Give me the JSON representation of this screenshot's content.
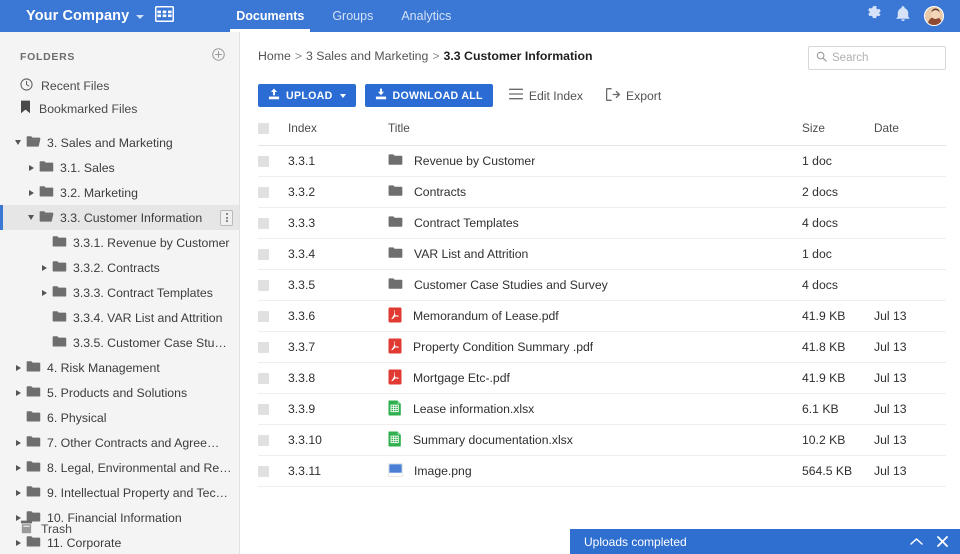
{
  "topbar": {
    "brand": "Your Company",
    "brand_caret_icon": "chevron-down-icon",
    "grid_icon": "grid-icon",
    "tabs": [
      {
        "label": "Documents",
        "active": true
      },
      {
        "label": "Groups",
        "active": false
      },
      {
        "label": "Analytics",
        "active": false
      }
    ],
    "gear_icon": "gear-icon",
    "bell_icon": "bell-icon",
    "avatar_icon": "avatar",
    "bg_color": "#3b77d4"
  },
  "sidebar": {
    "heading": "FOLDERS",
    "add_icon": "plus-circle-icon",
    "links": [
      {
        "label": "Recent Files",
        "icon": "clock-icon"
      },
      {
        "label": "Bookmarked Files",
        "icon": "bookmark-icon"
      }
    ],
    "tree": [
      {
        "label": "3. Sales and Marketing",
        "depth": 0,
        "caret": "down",
        "folder": "open",
        "selected": false
      },
      {
        "label": "3.1. Sales",
        "depth": 1,
        "caret": "right",
        "folder": "closed",
        "selected": false
      },
      {
        "label": "3.2. Marketing",
        "depth": 1,
        "caret": "right",
        "folder": "closed",
        "selected": false
      },
      {
        "label": "3.3. Customer Information",
        "depth": 1,
        "caret": "down",
        "folder": "open",
        "selected": true,
        "kebab": true
      },
      {
        "label": "3.3.1. Revenue by Customer",
        "depth": 2,
        "caret": "none",
        "folder": "closed",
        "selected": false
      },
      {
        "label": "3.3.2. Contracts",
        "depth": 2,
        "caret": "right",
        "folder": "closed",
        "selected": false
      },
      {
        "label": "3.3.3. Contract Templates",
        "depth": 2,
        "caret": "right",
        "folder": "closed",
        "selected": false
      },
      {
        "label": "3.3.4. VAR List and Attrition",
        "depth": 2,
        "caret": "none",
        "folder": "closed",
        "selected": false
      },
      {
        "label": "3.3.5. Customer Case Studi…",
        "depth": 2,
        "caret": "none",
        "folder": "closed",
        "selected": false
      },
      {
        "label": "4. Risk Management",
        "depth": 0,
        "caret": "right",
        "folder": "closed",
        "selected": false
      },
      {
        "label": "5. Products and Solutions",
        "depth": 0,
        "caret": "right",
        "folder": "closed",
        "selected": false
      },
      {
        "label": "6. Physical",
        "depth": 0,
        "caret": "none",
        "folder": "closed",
        "selected": false
      },
      {
        "label": "7. Other Contracts and Agree…",
        "depth": 0,
        "caret": "right",
        "folder": "closed",
        "selected": false
      },
      {
        "label": "8. Legal, Environmental and Re…",
        "depth": 0,
        "caret": "right",
        "folder": "closed",
        "selected": false
      },
      {
        "label": "9. Intellectual Property and Tec…",
        "depth": 0,
        "caret": "right",
        "folder": "closed",
        "selected": false
      },
      {
        "label": "10. Financial Information",
        "depth": 0,
        "caret": "right",
        "folder": "closed",
        "selected": false
      },
      {
        "label": "11. Corporate",
        "depth": 0,
        "caret": "right",
        "folder": "closed",
        "selected": false
      }
    ],
    "trash": {
      "label": "Trash",
      "icon": "trash-icon"
    }
  },
  "main": {
    "breadcrumb": [
      {
        "label": "Home",
        "current": false
      },
      {
        "label": "3 Sales and Marketing",
        "current": false
      },
      {
        "label": "3.3 Customer Information",
        "current": true
      }
    ],
    "breadcrumb_separator": ">",
    "search": {
      "placeholder": "Search",
      "value": "",
      "icon": "search-icon"
    },
    "toolbar": {
      "upload_label": "UPLOAD",
      "upload_icon": "upload-icon",
      "download_all_label": "DOWNLOAD ALL",
      "download_icon": "download-icon",
      "edit_index_label": "Edit Index",
      "edit_index_icon": "hamburger-icon",
      "export_label": "Export",
      "export_icon": "export-icon",
      "primary_color": "#2b6cd4"
    },
    "table": {
      "columns": [
        "Index",
        "Title",
        "Size",
        "Date"
      ],
      "rows": [
        {
          "index": "3.3.1",
          "title": "Revenue by Customer",
          "size": "1 doc",
          "date": "",
          "icon": "folder-icon"
        },
        {
          "index": "3.3.2",
          "title": "Contracts",
          "size": "2 docs",
          "date": "",
          "icon": "folder-icon"
        },
        {
          "index": "3.3.3",
          "title": "Contract Templates",
          "size": "4 docs",
          "date": "",
          "icon": "folder-icon"
        },
        {
          "index": "3.3.4",
          "title": "VAR List and Attrition",
          "size": "1 doc",
          "date": "",
          "icon": "folder-icon"
        },
        {
          "index": "3.3.5",
          "title": "Customer Case Studies and Survey",
          "size": "4 docs",
          "date": "",
          "icon": "folder-icon"
        },
        {
          "index": "3.3.6",
          "title": "Memorandum of Lease.pdf",
          "size": "41.9 KB",
          "date": "Jul 13",
          "icon": "pdf-icon"
        },
        {
          "index": "3.3.7",
          "title": "Property Condition Summary .pdf",
          "size": "41.8 KB",
          "date": "Jul 13",
          "icon": "pdf-icon"
        },
        {
          "index": "3.3.8",
          "title": "Mortgage Etc-.pdf",
          "size": "41.9 KB",
          "date": "Jul 13",
          "icon": "pdf-icon"
        },
        {
          "index": "3.3.9",
          "title": "Lease information.xlsx",
          "size": "6.1 KB",
          "date": "Jul 13",
          "icon": "xlsx-icon"
        },
        {
          "index": "3.3.10",
          "title": "Summary documentation.xlsx",
          "size": "10.2 KB",
          "date": "Jul 13",
          "icon": "xlsx-icon"
        },
        {
          "index": "3.3.11",
          "title": "Image.png",
          "size": "564.5 KB",
          "date": "Jul 13",
          "icon": "image-icon"
        }
      ]
    }
  },
  "toast": {
    "message": "Uploads completed",
    "collapse_icon": "chevron-up-icon",
    "close_icon": "close-icon",
    "bg_color": "#2f6fd0"
  }
}
